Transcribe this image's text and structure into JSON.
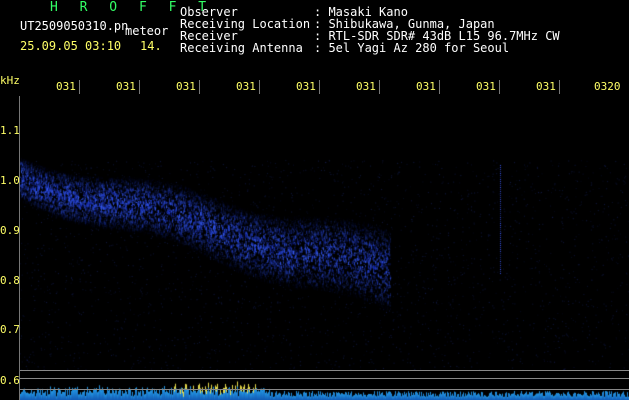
{
  "header": {
    "brand": "H R O F F T",
    "filename": "UT2509050310.pn",
    "tag": "meteor",
    "datetime": "25.09.05 03:10",
    "index": "14.",
    "info_labels": [
      "Observer",
      "Receiving Location",
      "Receiver",
      "Receiving Antenna"
    ],
    "info_values": [
      ": Masaki Kano",
      ": Shibukawa, Gunma, Japan",
      ": RTL-SDR SDR# 43dB L15 96.7MHz CW",
      ": 5el Yagi Az 280 for Seoul"
    ]
  },
  "plot": {
    "y_unit": "kHz",
    "y_ticks": [
      "1.1",
      "1.0",
      "0.9",
      "0.8",
      "0.7",
      "0.6"
    ],
    "x_ticks": [
      "031",
      "031",
      "031",
      "031",
      "031",
      "031",
      "031",
      "031",
      "031",
      "0320"
    ]
  },
  "colors": {
    "background": "#000000",
    "signal": "#3355ff",
    "noise": "#22aaff",
    "text_yellow": "#ffff66",
    "text_green": "#33ff66"
  }
}
